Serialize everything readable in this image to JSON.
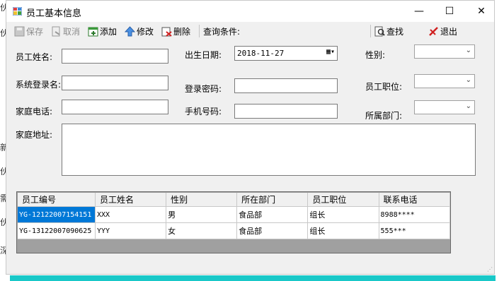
{
  "background_fragments": [
    "伙",
    "伙",
    "新",
    "伙",
    "需",
    "伙",
    "深"
  ],
  "window": {
    "title": "员工基本信息",
    "minimize": "—",
    "maximize": "☐",
    "close": "✕"
  },
  "toolbar": {
    "save": "保存",
    "cancel": "取消",
    "add": "添加",
    "edit": "修改",
    "delete": "删除",
    "query_label": "查询条件:",
    "find": "查找",
    "exit": "退出"
  },
  "form": {
    "name_label": "员工姓名:",
    "name_value": "",
    "birth_label": "出生日期:",
    "birth_value": "2018-11-27",
    "gender_label": "性别:",
    "gender_value": "",
    "login_label": "系统登录名:",
    "login_value": "",
    "password_label": "登录密码:",
    "password_value": "",
    "position_label": "员工职位:",
    "position_value": "",
    "home_phone_label": "家庭电话:",
    "home_phone_value": "",
    "mobile_label": "手机号码:",
    "mobile_value": "",
    "dept_label": "所属部门:",
    "dept_value": "",
    "address_label": "家庭地址:",
    "address_value": ""
  },
  "grid": {
    "columns": [
      "员工编号",
      "员工姓名",
      "性别",
      "所在部门",
      "员工职位",
      "联系电话"
    ],
    "rows": [
      [
        "YG-12122007154151",
        "XXX",
        "男",
        "食品部",
        "组长",
        "8988****"
      ],
      [
        "YG-13122007090625",
        "YYY",
        "女",
        "食品部",
        "组长",
        "555***"
      ]
    ]
  },
  "colors": {
    "accent_selection": "#0078d7",
    "teal_strip": "#19c8c8"
  }
}
